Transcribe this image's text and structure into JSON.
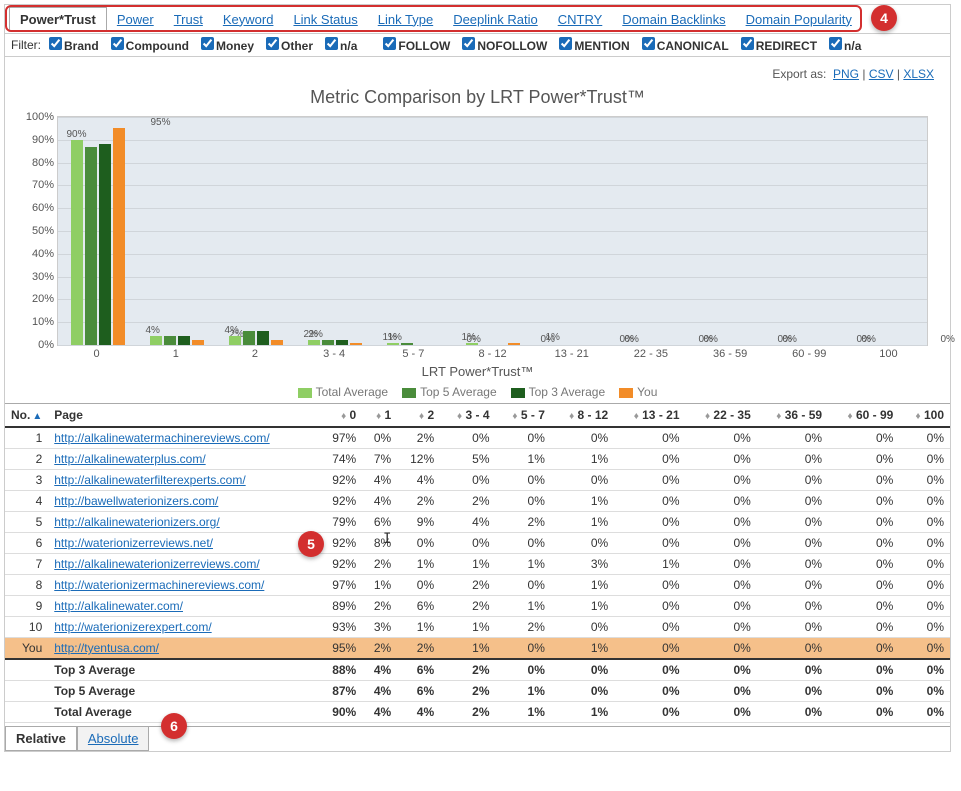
{
  "tabs": [
    "Power*Trust",
    "Power",
    "Trust",
    "Keyword",
    "Link Status",
    "Link Type",
    "Deeplink Ratio",
    "CNTRY",
    "Domain Backlinks",
    "Domain Popularity"
  ],
  "active_tab": 0,
  "filter_label": "Filter:",
  "filter_groups": {
    "anchor": [
      "Brand",
      "Compound",
      "Money",
      "Other",
      "n/a"
    ],
    "link": [
      "FOLLOW",
      "NOFOLLOW",
      "MENTION",
      "CANONICAL",
      "REDIRECT",
      "n/a"
    ]
  },
  "export_label": "Export as:",
  "export_links": [
    "PNG",
    "CSV",
    "XLSX"
  ],
  "chart_title": "Metric Comparison by LRT Power*Trust™",
  "axis_label": "LRT Power*Trust™",
  "legend": [
    {
      "label": "Total Average",
      "color": "#8fce64"
    },
    {
      "label": "Top 5 Average",
      "color": "#4a8c3b"
    },
    {
      "label": "Top 3 Average",
      "color": "#1e5e1e"
    },
    {
      "label": "You",
      "color": "#f28c28"
    }
  ],
  "chart_data": {
    "type": "bar",
    "categories": [
      "0",
      "1",
      "2",
      "3 - 4",
      "5 - 7",
      "8 - 12",
      "13 - 21",
      "22 - 35",
      "36 - 59",
      "60 - 99",
      "100"
    ],
    "series": [
      {
        "name": "Total Average",
        "values": [
          90,
          4,
          4,
          2,
          1,
          1,
          0,
          0,
          0,
          0,
          0
        ]
      },
      {
        "name": "Top 5 Average",
        "values": [
          87,
          4,
          6,
          2,
          1,
          0,
          0,
          0,
          0,
          0,
          0
        ]
      },
      {
        "name": "Top 3 Average",
        "values": [
          88,
          4,
          6,
          2,
          0,
          0,
          0,
          0,
          0,
          0,
          0
        ]
      },
      {
        "name": "You",
        "values": [
          95,
          2,
          2,
          1,
          0,
          1,
          0,
          0,
          0,
          0,
          0
        ]
      }
    ],
    "labels": [
      [
        "90%",
        "",
        "",
        "95%"
      ],
      [
        "4%",
        "",
        "",
        "2%"
      ],
      [
        "4%",
        "",
        "",
        "2%"
      ],
      [
        "2%",
        "",
        "",
        "1%"
      ],
      [
        "1%",
        "",
        "",
        "0%"
      ],
      [
        "1%",
        "",
        "",
        "1%"
      ],
      [
        "0%",
        "",
        "",
        "0%"
      ],
      [
        "0%",
        "",
        "",
        "0%"
      ],
      [
        "0%",
        "",
        "",
        "0%"
      ],
      [
        "0%",
        "",
        "",
        "0%"
      ],
      [
        "0%",
        "",
        "",
        "0%"
      ]
    ],
    "ylim": [
      0,
      100
    ],
    "yticks": [
      0,
      10,
      20,
      30,
      40,
      50,
      60,
      70,
      80,
      90,
      100
    ],
    "xlabel": "LRT Power*Trust™",
    "ylabel": ""
  },
  "table": {
    "headers": [
      "No.",
      "Page",
      "0",
      "1",
      "2",
      "3 - 4",
      "5 - 7",
      "8 - 12",
      "13 - 21",
      "22 - 35",
      "36 - 59",
      "60 - 99",
      "100"
    ],
    "rows": [
      {
        "no": "1",
        "page": "http://alkalinewatermachinereviews.com/",
        "vals": [
          "97%",
          "0%",
          "2%",
          "0%",
          "0%",
          "0%",
          "0%",
          "0%",
          "0%",
          "0%",
          "0%"
        ]
      },
      {
        "no": "2",
        "page": "http://alkalinewaterplus.com/",
        "vals": [
          "74%",
          "7%",
          "12%",
          "5%",
          "1%",
          "1%",
          "0%",
          "0%",
          "0%",
          "0%",
          "0%"
        ]
      },
      {
        "no": "3",
        "page": "http://alkalinewaterfilterexperts.com/",
        "vals": [
          "92%",
          "4%",
          "4%",
          "0%",
          "0%",
          "0%",
          "0%",
          "0%",
          "0%",
          "0%",
          "0%"
        ]
      },
      {
        "no": "4",
        "page": "http://bawellwaterionizers.com/",
        "vals": [
          "92%",
          "4%",
          "2%",
          "2%",
          "0%",
          "1%",
          "0%",
          "0%",
          "0%",
          "0%",
          "0%"
        ]
      },
      {
        "no": "5",
        "page": "http://alkalinewaterionizers.org/",
        "vals": [
          "79%",
          "6%",
          "9%",
          "4%",
          "2%",
          "1%",
          "0%",
          "0%",
          "0%",
          "0%",
          "0%"
        ]
      },
      {
        "no": "6",
        "page": "http://waterionizerreviews.net/",
        "vals": [
          "92%",
          "8%",
          "0%",
          "0%",
          "0%",
          "0%",
          "0%",
          "0%",
          "0%",
          "0%",
          "0%"
        ]
      },
      {
        "no": "7",
        "page": "http://alkalinewaterionizerreviews.com/",
        "vals": [
          "92%",
          "2%",
          "1%",
          "1%",
          "1%",
          "3%",
          "1%",
          "0%",
          "0%",
          "0%",
          "0%"
        ]
      },
      {
        "no": "8",
        "page": "http://waterionizermachinereviews.com/",
        "vals": [
          "97%",
          "1%",
          "0%",
          "2%",
          "0%",
          "1%",
          "0%",
          "0%",
          "0%",
          "0%",
          "0%"
        ]
      },
      {
        "no": "9",
        "page": "http://alkalinewater.com/",
        "vals": [
          "89%",
          "2%",
          "6%",
          "2%",
          "1%",
          "1%",
          "0%",
          "0%",
          "0%",
          "0%",
          "0%"
        ]
      },
      {
        "no": "10",
        "page": "http://waterionizerexpert.com/",
        "vals": [
          "93%",
          "3%",
          "1%",
          "1%",
          "2%",
          "0%",
          "0%",
          "0%",
          "0%",
          "0%",
          "0%"
        ]
      },
      {
        "no": "You",
        "page": "http://tyentusa.com/",
        "vals": [
          "95%",
          "2%",
          "2%",
          "1%",
          "0%",
          "1%",
          "0%",
          "0%",
          "0%",
          "0%",
          "0%"
        ],
        "you": true
      }
    ],
    "summary": [
      {
        "label": "Top 3 Average",
        "vals": [
          "88%",
          "4%",
          "6%",
          "2%",
          "0%",
          "0%",
          "0%",
          "0%",
          "0%",
          "0%",
          "0%"
        ]
      },
      {
        "label": "Top 5 Average",
        "vals": [
          "87%",
          "4%",
          "6%",
          "2%",
          "1%",
          "0%",
          "0%",
          "0%",
          "0%",
          "0%",
          "0%"
        ]
      },
      {
        "label": "Total Average",
        "vals": [
          "90%",
          "4%",
          "4%",
          "2%",
          "1%",
          "1%",
          "0%",
          "0%",
          "0%",
          "0%",
          "0%"
        ]
      }
    ]
  },
  "bottom_tabs": [
    "Relative",
    "Absolute"
  ],
  "bottom_active": 0,
  "badges": {
    "4": "4",
    "5": "5",
    "6": "6"
  }
}
